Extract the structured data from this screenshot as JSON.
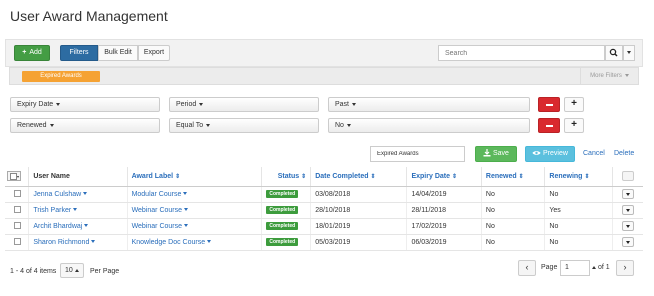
{
  "page": {
    "title": "User Award Management"
  },
  "toolbar": {
    "add_label": "Add",
    "filters_label": "Filters",
    "bulk_edit_label": "Bulk Edit",
    "export_label": "Export",
    "search_placeholder": "Search"
  },
  "tagbar": {
    "tag_label": "Expired Awards",
    "more_filters_label": "More Filters"
  },
  "filters": [
    {
      "field": "Expiry Date",
      "operator": "Period",
      "value": "Past"
    },
    {
      "field": "Renewed",
      "operator": "Equal To",
      "value": "No"
    }
  ],
  "actions": {
    "filter_name_value": "Expired Awards",
    "save_label": "Save",
    "preview_label": "Preview",
    "cancel_label": "Cancel",
    "delete_label": "Delete"
  },
  "table": {
    "columns": [
      "User Name",
      "Award Label",
      "Status",
      "Date Completed",
      "Expiry Date",
      "Renewed",
      "Renewing"
    ],
    "rows": [
      {
        "user": "Jenna Culshaw",
        "award": "Modular Course",
        "status": "Completed",
        "completed": "03/08/2018",
        "expiry": "14/04/2019",
        "renewed": "No",
        "renewing": "No"
      },
      {
        "user": "Trish Parker",
        "award": "Webinar Course",
        "status": "Completed",
        "completed": "28/10/2018",
        "expiry": "28/11/2018",
        "renewed": "No",
        "renewing": "Yes"
      },
      {
        "user": "Archit Bhardwaj",
        "award": "Webinar Course",
        "status": "Completed",
        "completed": "18/01/2019",
        "expiry": "17/02/2019",
        "renewed": "No",
        "renewing": "No"
      },
      {
        "user": "Sharon Richmond",
        "award": "Knowledge Doc Course",
        "status": "Completed",
        "completed": "05/03/2019",
        "expiry": "06/03/2019",
        "renewed": "No",
        "renewing": "No"
      }
    ]
  },
  "footer": {
    "items_count": "1 - 4 of 4 items",
    "per_page_value": "10",
    "per_page_label": "Per Page",
    "page_label": "Page",
    "page_value": "1",
    "page_of": "of 1"
  },
  "colors": {
    "add": "#449d44",
    "filters": "#2d6ca2",
    "tag": "#f5a233",
    "remove": "#d9292e",
    "save": "#5cb85c",
    "preview": "#5bc0de",
    "link": "#2a6ebb",
    "status": "#3d9c3d"
  }
}
